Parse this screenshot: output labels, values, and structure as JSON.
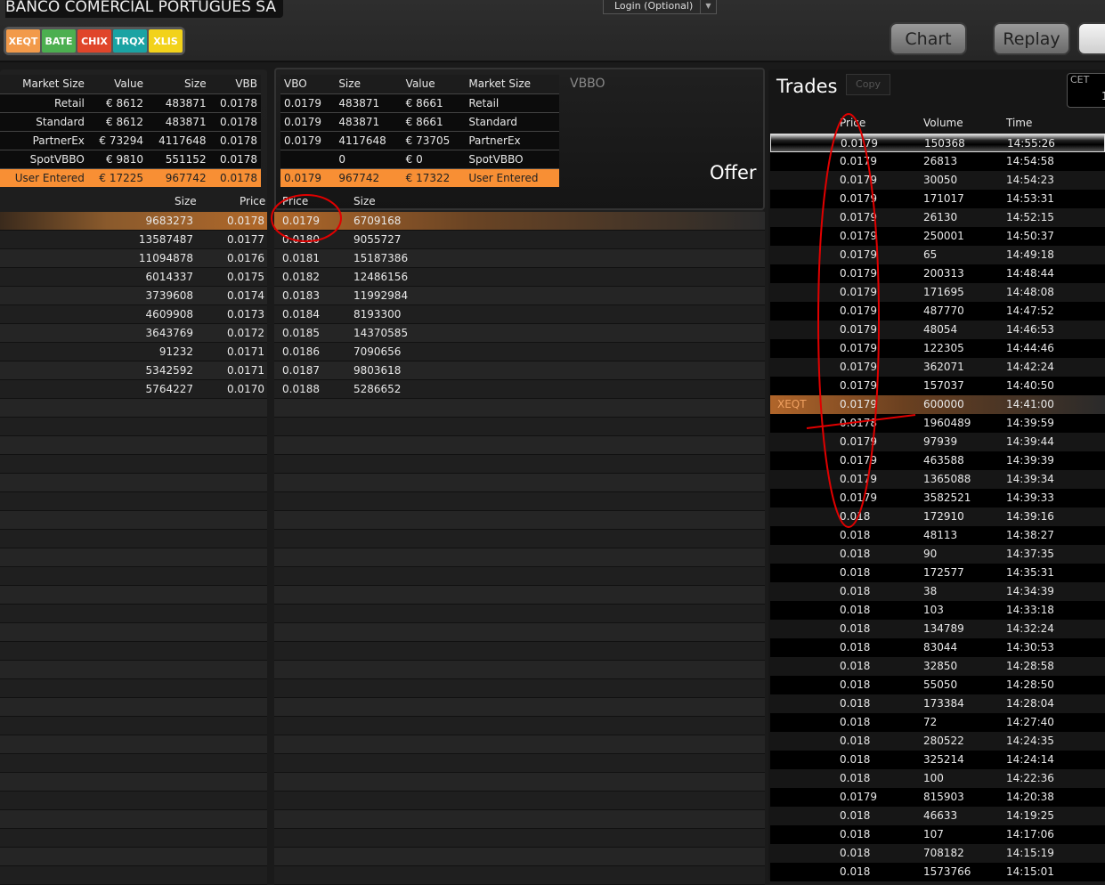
{
  "header": {
    "title": "BANCO COMERCIAL PORTUGUES SA",
    "login": "Login (Optional)",
    "chart": "Chart",
    "replay": "Replay",
    "venues": [
      {
        "label": "XEQT",
        "color": "#f29a4a"
      },
      {
        "label": "BATE",
        "color": "#4caf50"
      },
      {
        "label": "CHIX",
        "color": "#e0452a"
      },
      {
        "label": "TRQX",
        "color": "#1aa3a3"
      },
      {
        "label": "XLIS",
        "color": "#f2d21a"
      }
    ]
  },
  "bid_summary": {
    "headers": [
      "Market Size",
      "Value",
      "Size",
      "VBB"
    ],
    "rows": [
      [
        "Retail",
        "€ 8612",
        "483871",
        "0.0178"
      ],
      [
        "Standard",
        "€ 8612",
        "483871",
        "0.0178"
      ],
      [
        "PartnerEx",
        "€ 73294",
        "4117648",
        "0.0178"
      ],
      [
        "SpotVBBO",
        "€ 9810",
        "551152",
        "0.0178"
      ],
      [
        "User Entered",
        "€ 17225",
        "967742",
        "0.0178"
      ]
    ]
  },
  "offer_summary": {
    "headers": [
      "VBO",
      "Size",
      "Value",
      "Market Size"
    ],
    "rows": [
      [
        "0.0179",
        "483871",
        "€ 8661",
        "Retail"
      ],
      [
        "0.0179",
        "483871",
        "€ 8661",
        "Standard"
      ],
      [
        "0.0179",
        "4117648",
        "€ 73705",
        "PartnerEx"
      ],
      [
        "",
        "0",
        "€ 0",
        "SpotVBBO"
      ],
      [
        "0.0179",
        "967742",
        "€ 17322",
        "User Entered"
      ]
    ],
    "vbbo_label": "VBBO",
    "offer_label": "Offer"
  },
  "bid_depth": {
    "headers": [
      "Size",
      "Price"
    ],
    "rows": [
      [
        "9683273",
        "0.0178"
      ],
      [
        "13587487",
        "0.0177"
      ],
      [
        "11094878",
        "0.0176"
      ],
      [
        "6014337",
        "0.0175"
      ],
      [
        "3739608",
        "0.0174"
      ],
      [
        "4609908",
        "0.0173"
      ],
      [
        "3643769",
        "0.0172"
      ],
      [
        "91232",
        "0.0171"
      ],
      [
        "5342592",
        "0.0171"
      ],
      [
        "5764227",
        "0.0170"
      ]
    ]
  },
  "offer_depth": {
    "headers": [
      "Price",
      "Size"
    ],
    "rows": [
      [
        "0.0179",
        "6709168"
      ],
      [
        "0.0180",
        "9055727"
      ],
      [
        "0.0181",
        "15187386"
      ],
      [
        "0.0182",
        "12486156"
      ],
      [
        "0.0183",
        "11992984"
      ],
      [
        "0.0184",
        "8193300"
      ],
      [
        "0.0185",
        "14370585"
      ],
      [
        "0.0186",
        "7090656"
      ],
      [
        "0.0187",
        "9803618"
      ],
      [
        "0.0188",
        "5286652"
      ]
    ]
  },
  "trades": {
    "title": "Trades",
    "copy": "Copy",
    "tz": "CET",
    "tz_value": "1",
    "headers": [
      "Price",
      "Volume",
      "Time"
    ],
    "rows": [
      [
        "",
        "0.0179",
        "150368",
        "14:55:26"
      ],
      [
        "",
        "0.0179",
        "26813",
        "14:54:58"
      ],
      [
        "",
        "0.0179",
        "30050",
        "14:54:23"
      ],
      [
        "",
        "0.0179",
        "171017",
        "14:53:31"
      ],
      [
        "",
        "0.0179",
        "26130",
        "14:52:15"
      ],
      [
        "",
        "0.0179",
        "250001",
        "14:50:37"
      ],
      [
        "",
        "0.0179",
        "65",
        "14:49:18"
      ],
      [
        "",
        "0.0179",
        "200313",
        "14:48:44"
      ],
      [
        "",
        "0.0179",
        "171695",
        "14:48:08"
      ],
      [
        "",
        "0.0179",
        "487770",
        "14:47:52"
      ],
      [
        "",
        "0.0179",
        "48054",
        "14:46:53"
      ],
      [
        "",
        "0.0179",
        "122305",
        "14:44:46"
      ],
      [
        "",
        "0.0179",
        "362071",
        "14:42:24"
      ],
      [
        "",
        "0.0179",
        "157037",
        "14:40:50"
      ],
      [
        "XEQT",
        "0.0179",
        "600000",
        "14:41:00"
      ],
      [
        "",
        "0.0178",
        "1960489",
        "14:39:59"
      ],
      [
        "",
        "0.0179",
        "97939",
        "14:39:44"
      ],
      [
        "",
        "0.0179",
        "463588",
        "14:39:39"
      ],
      [
        "",
        "0.0179",
        "1365088",
        "14:39:34"
      ],
      [
        "",
        "0.0179",
        "3582521",
        "14:39:33"
      ],
      [
        "",
        "0.018",
        "172910",
        "14:39:16"
      ],
      [
        "",
        "0.018",
        "48113",
        "14:38:27"
      ],
      [
        "",
        "0.018",
        "90",
        "14:37:35"
      ],
      [
        "",
        "0.018",
        "172577",
        "14:35:31"
      ],
      [
        "",
        "0.018",
        "38",
        "14:34:39"
      ],
      [
        "",
        "0.018",
        "103",
        "14:33:18"
      ],
      [
        "",
        "0.018",
        "134789",
        "14:32:24"
      ],
      [
        "",
        "0.018",
        "83044",
        "14:30:53"
      ],
      [
        "",
        "0.018",
        "32850",
        "14:28:58"
      ],
      [
        "",
        "0.018",
        "55050",
        "14:28:50"
      ],
      [
        "",
        "0.018",
        "173384",
        "14:28:04"
      ],
      [
        "",
        "0.018",
        "72",
        "14:27:40"
      ],
      [
        "",
        "0.018",
        "280522",
        "14:24:35"
      ],
      [
        "",
        "0.018",
        "325214",
        "14:24:14"
      ],
      [
        "",
        "0.018",
        "100",
        "14:22:36"
      ],
      [
        "",
        "0.0179",
        "815903",
        "14:20:38"
      ],
      [
        "",
        "0.018",
        "46633",
        "14:19:25"
      ],
      [
        "",
        "0.018",
        "107",
        "14:17:06"
      ],
      [
        "",
        "0.018",
        "708182",
        "14:15:19"
      ],
      [
        "",
        "0.018",
        "1573766",
        "14:15:01"
      ]
    ]
  },
  "colors": {
    "accent": "#f88f34",
    "annotation": "#e00000"
  }
}
